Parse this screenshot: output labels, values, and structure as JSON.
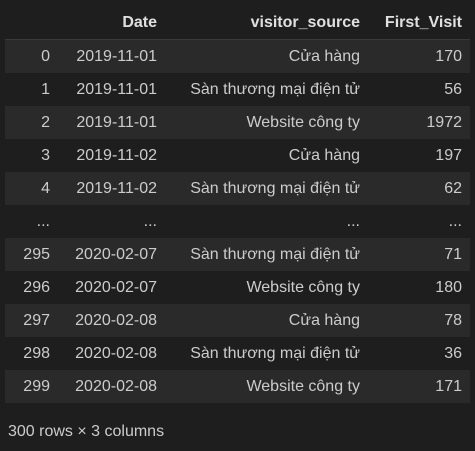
{
  "dataframe": {
    "columns": [
      "",
      "Date",
      "visitor_source",
      "First_Visit"
    ],
    "rows": [
      {
        "index": "0",
        "date": "2019-11-01",
        "source": "Cửa hàng",
        "first_visit": "170"
      },
      {
        "index": "1",
        "date": "2019-11-01",
        "source": "Sàn thương mại điện tử",
        "first_visit": "56"
      },
      {
        "index": "2",
        "date": "2019-11-01",
        "source": "Website công ty",
        "first_visit": "1972"
      },
      {
        "index": "3",
        "date": "2019-11-02",
        "source": "Cửa hàng",
        "first_visit": "197"
      },
      {
        "index": "4",
        "date": "2019-11-02",
        "source": "Sàn thương mại điện tử",
        "first_visit": "62"
      },
      {
        "index": "...",
        "date": "...",
        "source": "...",
        "first_visit": "..."
      },
      {
        "index": "295",
        "date": "2020-02-07",
        "source": "Sàn thương mại điện tử",
        "first_visit": "71"
      },
      {
        "index": "296",
        "date": "2020-02-07",
        "source": "Website công ty",
        "first_visit": "180"
      },
      {
        "index": "297",
        "date": "2020-02-08",
        "source": "Cửa hàng",
        "first_visit": "78"
      },
      {
        "index": "298",
        "date": "2020-02-08",
        "source": "Sàn thương mại điện tử",
        "first_visit": "36"
      },
      {
        "index": "299",
        "date": "2020-02-08",
        "source": "Website công ty",
        "first_visit": "171"
      }
    ],
    "footer": "300 rows × 3 columns"
  }
}
